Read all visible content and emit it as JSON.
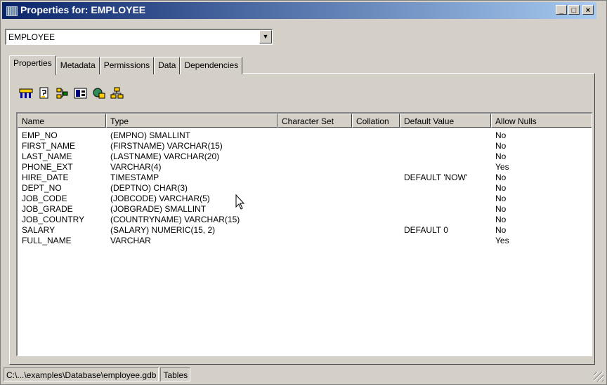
{
  "window": {
    "title": "Properties for: EMPLOYEE",
    "controls": {
      "minimize": "_",
      "maximize": "□",
      "close": "×"
    }
  },
  "object_selector": {
    "value": "EMPLOYEE",
    "arrow": "▼"
  },
  "tabs": [
    {
      "label": "Properties",
      "active": true
    },
    {
      "label": "Metadata",
      "active": false
    },
    {
      "label": "Permissions",
      "active": false
    },
    {
      "label": "Data",
      "active": false
    },
    {
      "label": "Dependencies",
      "active": false
    }
  ],
  "toolbar": [
    {
      "icon": "show-columns-icon"
    },
    {
      "icon": "show-triggers-icon"
    },
    {
      "icon": "show-check-constraints-icon"
    },
    {
      "icon": "show-indexes-icon"
    },
    {
      "icon": "show-unique-constraints-icon"
    },
    {
      "icon": "show-referential-constraints-icon"
    }
  ],
  "columns": {
    "headers": [
      "Name",
      "Type",
      "Character Set",
      "Collation",
      "Default Value",
      "Allow Nulls"
    ],
    "rows": [
      [
        "EMP_NO",
        "(EMPNO) SMALLINT",
        "",
        "",
        "",
        "No"
      ],
      [
        "FIRST_NAME",
        "(FIRSTNAME) VARCHAR(15)",
        "",
        "",
        "",
        "No"
      ],
      [
        "LAST_NAME",
        "(LASTNAME) VARCHAR(20)",
        "",
        "",
        "",
        "No"
      ],
      [
        "PHONE_EXT",
        "VARCHAR(4)",
        "",
        "",
        "",
        "Yes"
      ],
      [
        "HIRE_DATE",
        "TIMESTAMP",
        "",
        "",
        "DEFAULT 'NOW'",
        "No"
      ],
      [
        "DEPT_NO",
        "(DEPTNO) CHAR(3)",
        "",
        "",
        "",
        "No"
      ],
      [
        "JOB_CODE",
        "(JOBCODE) VARCHAR(5)",
        "",
        "",
        "",
        "No"
      ],
      [
        "JOB_GRADE",
        "(JOBGRADE) SMALLINT",
        "",
        "",
        "",
        "No"
      ],
      [
        "JOB_COUNTRY",
        "(COUNTRYNAME) VARCHAR(15)",
        "",
        "",
        "",
        "No"
      ],
      [
        "SALARY",
        "(SALARY) NUMERIC(15, 2)",
        "",
        "",
        "DEFAULT 0",
        "No"
      ],
      [
        "FULL_NAME",
        "VARCHAR",
        "",
        "",
        "",
        "Yes"
      ]
    ]
  },
  "statusbar": {
    "path": "C:\\...\\examples\\Database\\employee.gdb",
    "section": "Tables"
  },
  "colors": {
    "title_start": "#0a246a",
    "title_end": "#a6caf0",
    "face": "#d4d0c8"
  }
}
